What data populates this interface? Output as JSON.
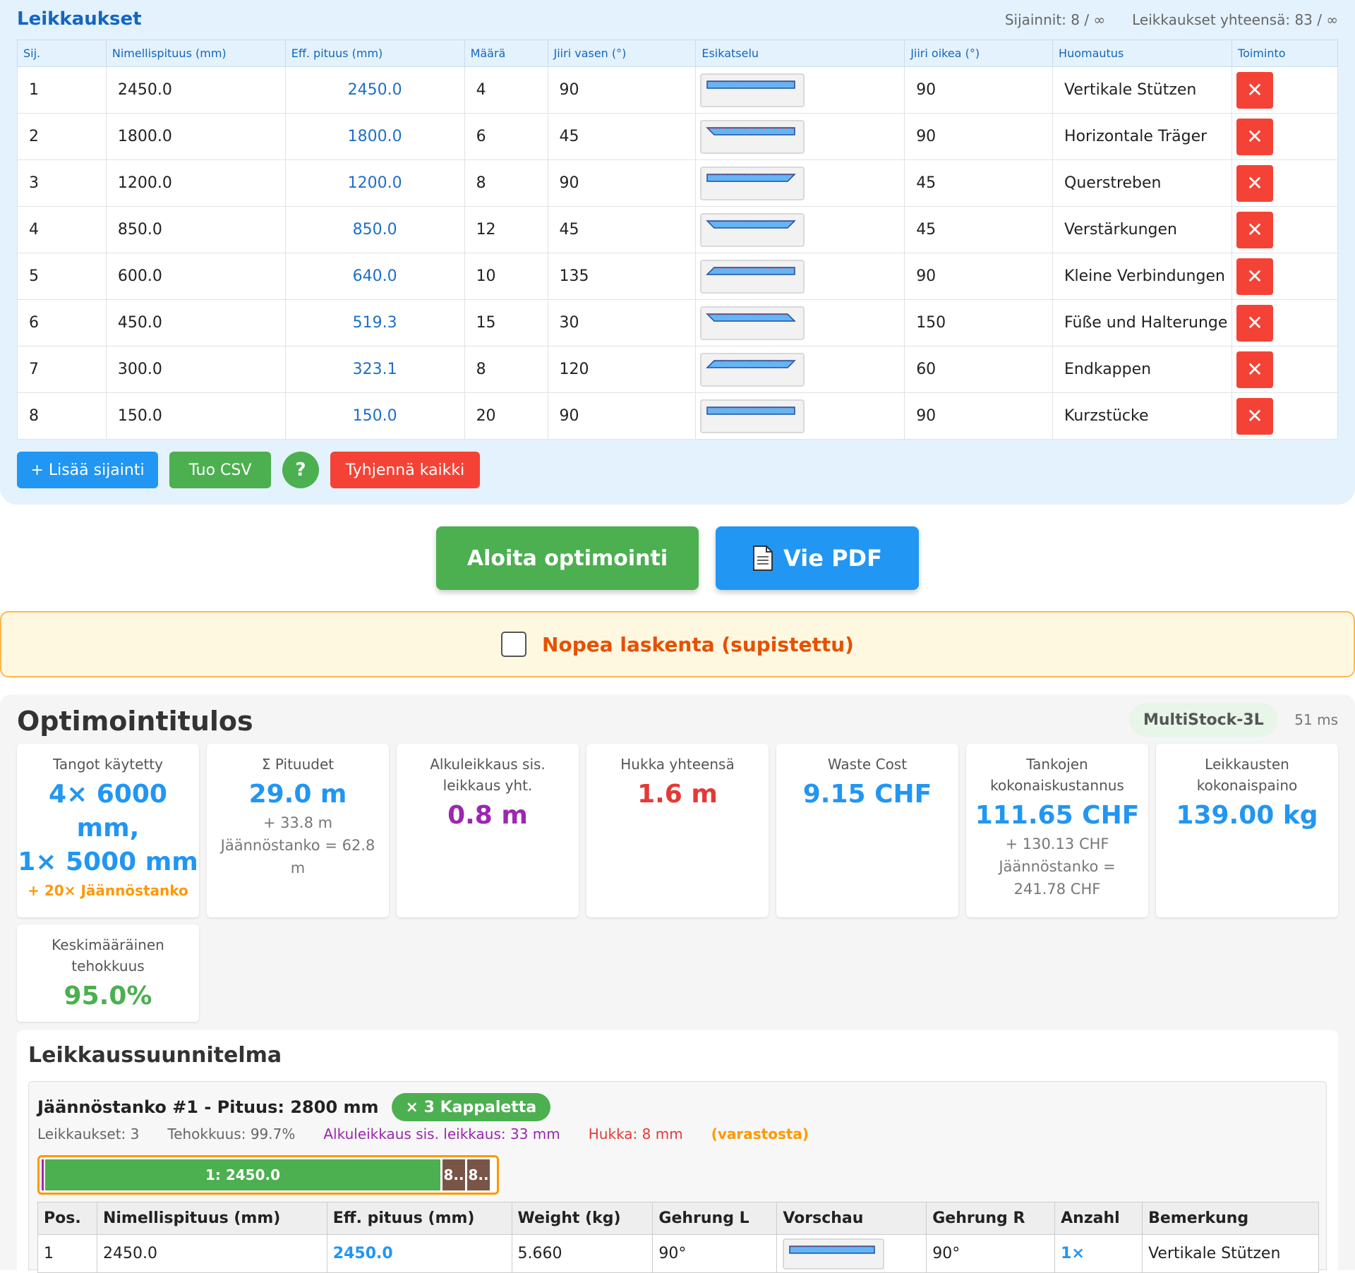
{
  "cuts": {
    "title": "Leikkaukset",
    "positions_stat": "Sijainnit: 8 / ∞",
    "total_stat": "Leikkaukset yhteensä: 83 / ∞",
    "headers": [
      "Sij.",
      "Nimellispituus (mm)",
      "Eff. pituus (mm)",
      "Määrä",
      "Jiiri vasen (°)",
      "Esikatselu",
      "Jiiri oikea (°)",
      "Huomautus",
      "Toiminto"
    ],
    "rows": [
      {
        "pos": "1",
        "nominal": "2450.0",
        "eff": "2450.0",
        "qty": "4",
        "left": "90",
        "right": "90",
        "note": "Vertikale Stützen"
      },
      {
        "pos": "2",
        "nominal": "1800.0",
        "eff": "1800.0",
        "qty": "6",
        "left": "45",
        "right": "90",
        "note": "Horizontale Träger"
      },
      {
        "pos": "3",
        "nominal": "1200.0",
        "eff": "1200.0",
        "qty": "8",
        "left": "90",
        "right": "45",
        "note": "Querstreben"
      },
      {
        "pos": "4",
        "nominal": "850.0",
        "eff": "850.0",
        "qty": "12",
        "left": "45",
        "right": "45",
        "note": "Verstärkungen"
      },
      {
        "pos": "5",
        "nominal": "600.0",
        "eff": "640.0",
        "qty": "10",
        "left": "135",
        "right": "90",
        "note": "Kleine Verbindungen"
      },
      {
        "pos": "6",
        "nominal": "450.0",
        "eff": "519.3",
        "qty": "15",
        "left": "30",
        "right": "150",
        "note": "Füße und Halterunge"
      },
      {
        "pos": "7",
        "nominal": "300.0",
        "eff": "323.1",
        "qty": "8",
        "left": "120",
        "right": "60",
        "note": "Endkappen"
      },
      {
        "pos": "8",
        "nominal": "150.0",
        "eff": "150.0",
        "qty": "20",
        "left": "90",
        "right": "90",
        "note": "Kurzstücke"
      }
    ],
    "delete_icon": "close-icon",
    "buttons": {
      "add": "+ Lisää sijainti",
      "import": "Tuo CSV",
      "help": "?",
      "clear": "Tyhjennä kaikki"
    }
  },
  "actions": {
    "start": "Aloita optimointi",
    "pdf": "Vie PDF",
    "pdf_icon": "document-icon",
    "fast_label": "Nopea laskenta (supistettu)"
  },
  "results": {
    "title": "Optimointitulos",
    "algorithm": "MultiStock-3L",
    "time": "51 ms",
    "cards": {
      "bars_used": {
        "label": "Tangot käytetty",
        "line1": "4× 6000 mm,",
        "line2": "1× 5000 mm",
        "extra": "+ 20× Jäännöstanko"
      },
      "lengths": {
        "label": "Σ Pituudet",
        "value": "29.0 m",
        "sub": "+ 33.8 m Jäännöstanko = 62.8 m"
      },
      "kerf": {
        "label": "Alkuleikkaus sis. leikkaus yht.",
        "value": "0.8 m"
      },
      "waste": {
        "label": "Hukka yhteensä",
        "value": "1.6 m"
      },
      "waste_cost": {
        "label": "Waste Cost",
        "value": "9.15 CHF"
      },
      "cost": {
        "label": "Tankojen kokonaiskustannus",
        "value": "111.65 CHF",
        "sub": "+ 130.13 CHF Jäännöstanko = 241.78 CHF"
      },
      "weight": {
        "label": "Leikkausten kokonaispaino",
        "value": "139.00 kg"
      },
      "efficiency": {
        "label": "Keskimääräinen tehokkuus",
        "value": "95.0%"
      }
    },
    "colors": {
      "blue": "#2196f3",
      "purple": "#9c27b0",
      "red": "#e53935",
      "green": "#4caf50",
      "orange": "#ff9800"
    }
  },
  "plan": {
    "title": "Leikkaussuunnitelma",
    "bar": {
      "title": "Jäännöstanko #1 - Pituus: 2800 mm",
      "count": "× 3 Kappaletta",
      "stat_cuts": "Leikkaukset: 3",
      "stat_eff": "Tehokkuus: 99.7%",
      "stat_kerf": "Alkuleikkaus sis. leikkaus: 33 mm",
      "stat_waste": "Hukka: 8 mm",
      "stat_source": "(varastosta)",
      "segments": [
        {
          "label": "1: 2450.0",
          "length_mm": 2450,
          "color": "#4caf50"
        },
        {
          "label": "8..",
          "length_mm": 150,
          "color": "#795548"
        },
        {
          "label": "8..",
          "length_mm": 150,
          "color": "#795548"
        }
      ]
    },
    "headers": [
      "Pos.",
      "Nimellispituus (mm)",
      "Eff. pituus (mm)",
      "Weight (kg)",
      "Gehrung L",
      "Vorschau",
      "Gehrung R",
      "Anzahl",
      "Bemerkung"
    ],
    "rows": [
      {
        "pos": "1",
        "nominal": "2450.0",
        "eff": "2450.0",
        "weight": "5.660",
        "left": "90°",
        "right": "90°",
        "count": "1×",
        "note": "Vertikale Stützen"
      }
    ]
  }
}
